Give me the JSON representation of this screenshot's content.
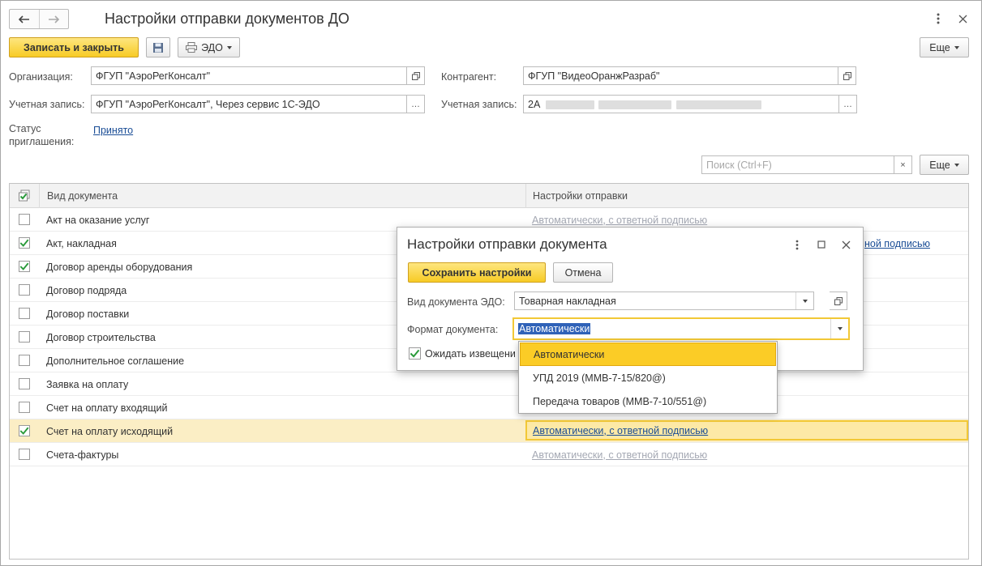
{
  "window": {
    "title": "Настройки отправки документов ДО"
  },
  "toolbar": {
    "save_close": "Записать и закрыть",
    "edo": "ЭДО",
    "more": "Еще"
  },
  "form": {
    "org_label": "Организация:",
    "org_value": "ФГУП \"АэроРегКонсалт\"",
    "account_label": "Учетная запись:",
    "account_value": "ФГУП \"АэроРегКонсалт\", Через сервис 1С-ЭДО",
    "status_label_1": "Статус",
    "status_label_2": "приглашения:",
    "status_value": "Принято",
    "counterparty_label": "Контрагент:",
    "counterparty_value": "ФГУП \"ВидеоОранжРазраб\"",
    "cp_account_label": "Учетная запись:",
    "cp_account_value": "2А"
  },
  "search": {
    "placeholder": "Поиск (Ctrl+F)",
    "clear": "×",
    "more": "Еще"
  },
  "table": {
    "col_doc": "Вид документа",
    "col_settings": "Настройки отправки",
    "rows": [
      {
        "name": "Акт на оказание услуг",
        "checked": false,
        "setting": "Автоматически, с ответной подписью"
      },
      {
        "name": "Акт, накладная",
        "checked": true,
        "setting": "Автоматически, с ответной подписью"
      },
      {
        "name": "Договор аренды оборудования",
        "checked": true,
        "setting": ""
      },
      {
        "name": "Договор подряда",
        "checked": false,
        "setting": ""
      },
      {
        "name": "Договор поставки",
        "checked": false,
        "setting": ""
      },
      {
        "name": "Договор строительства",
        "checked": false,
        "setting": ""
      },
      {
        "name": "Дополнительное соглашение",
        "checked": false,
        "setting": ""
      },
      {
        "name": "Заявка на оплату",
        "checked": false,
        "setting": ""
      },
      {
        "name": "Счет на оплату входящий",
        "checked": false,
        "setting": ""
      },
      {
        "name": "Счет на оплату исходящий",
        "checked": true,
        "setting": "Автоматически, с ответной подписью"
      },
      {
        "name": "Счета-фактуры",
        "checked": false,
        "setting": "Автоматически, с ответной подписью"
      }
    ],
    "row1_visible_setting": "ной подписью"
  },
  "dialog": {
    "title": "Настройки отправки документа",
    "save": "Сохранить настройки",
    "cancel": "Отмена",
    "doc_type_label": "Вид документа ЭДО:",
    "doc_type_value": "Товарная накладная",
    "format_label": "Формат документа:",
    "format_value": "Автоматически",
    "wait_label": "Ожидать извещени",
    "wait_checked": true
  },
  "dropdown": {
    "options": [
      "Автоматически",
      "УПД 2019 (ММВ-7-15/820@)",
      "Передача товаров (ММВ-7-10/551@)"
    ],
    "selected": "Автоматически"
  },
  "colors": {
    "accent_yellow": "#f7cb25",
    "link_blue": "#1a4d96",
    "selected_row": "#fbeec5",
    "check_green": "#2a9a3a"
  }
}
